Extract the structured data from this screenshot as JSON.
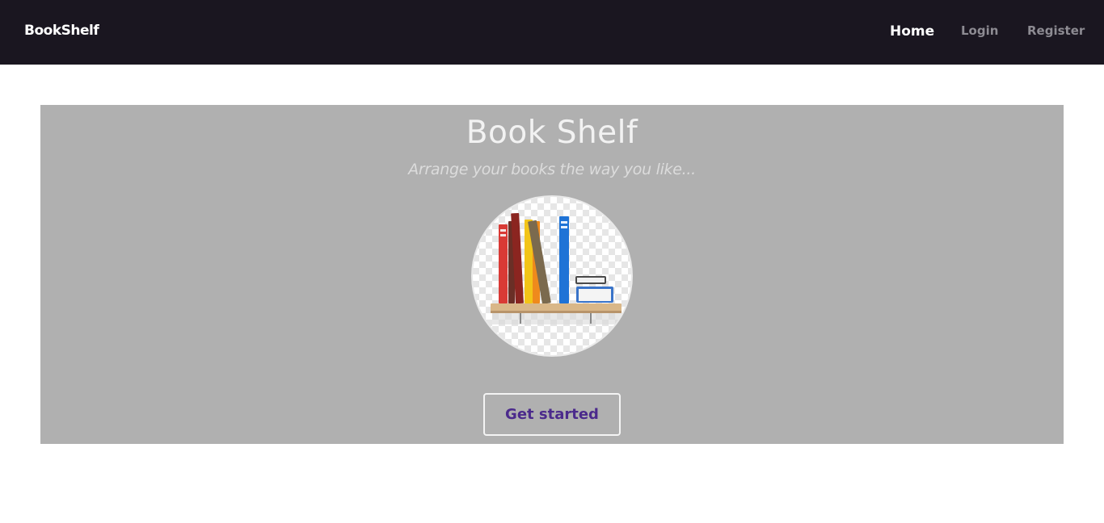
{
  "navbar": {
    "brand": "BookShelf",
    "links": [
      {
        "label": "Home",
        "active": true
      },
      {
        "label": "Login",
        "active": false
      },
      {
        "label": "Register",
        "active": false
      }
    ]
  },
  "hero": {
    "title": "Book Shelf",
    "subtitle": "Arrange your books the way you like...",
    "image_icon": "bookshelf-illustration",
    "cta_label": "Get started"
  },
  "colors": {
    "navbar_bg": "#1a1620",
    "hero_bg": "#b0b0b0",
    "cta_text": "#4b2a8c"
  }
}
